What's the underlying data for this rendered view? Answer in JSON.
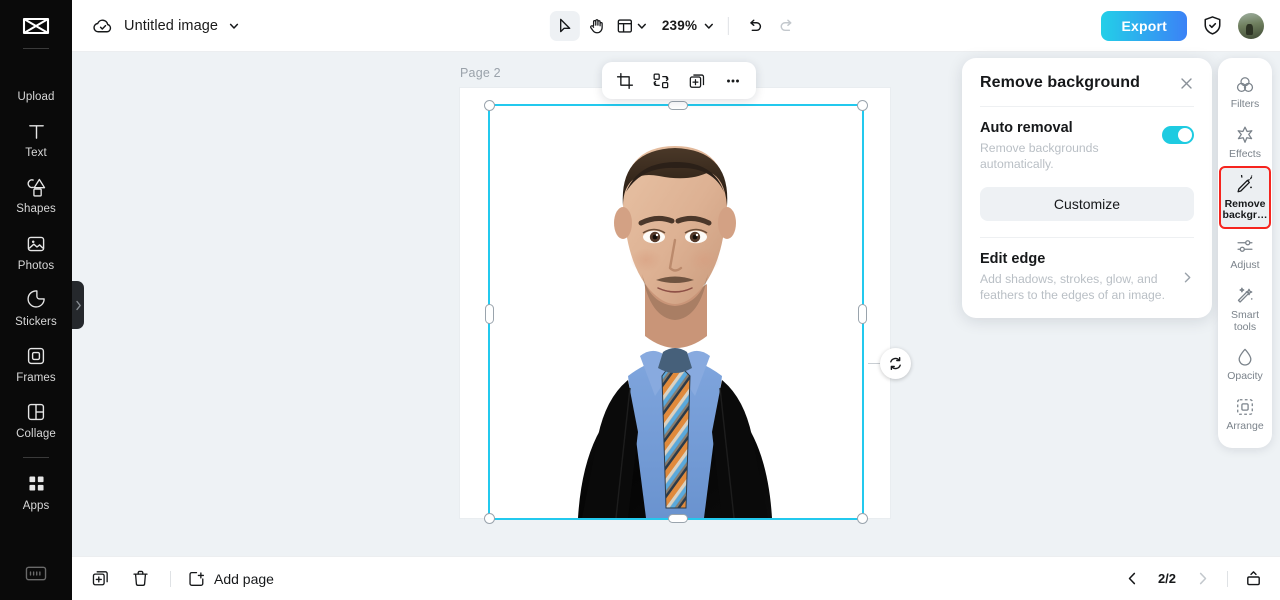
{
  "app": {
    "logo_icon": "capcut-logo-icon"
  },
  "left_sidebar": {
    "items": [
      {
        "label": "Upload",
        "icon": "upload-icon"
      },
      {
        "label": "Text",
        "icon": "text-icon"
      },
      {
        "label": "Shapes",
        "icon": "shapes-icon"
      },
      {
        "label": "Photos",
        "icon": "photos-icon"
      },
      {
        "label": "Stickers",
        "icon": "stickers-icon"
      },
      {
        "label": "Frames",
        "icon": "frames-icon"
      },
      {
        "label": "Collage",
        "icon": "collage-icon"
      },
      {
        "label": "Apps",
        "icon": "apps-icon"
      }
    ],
    "keyboard_shortcut_icon": "keyboard-icon",
    "collapse_icon": "chevron-right-icon"
  },
  "topbar": {
    "cloud_status_icon": "cloud-saved-icon",
    "document_title": "Untitled image",
    "title_dropdown_icon": "chevron-down-icon",
    "tools": [
      {
        "name": "select-tool",
        "icon": "cursor-arrow-icon",
        "active": true
      },
      {
        "name": "hand-tool",
        "icon": "hand-icon",
        "active": false
      },
      {
        "name": "layout-tool",
        "icon": "layout-icon",
        "active": false
      }
    ],
    "zoom_level": "239%",
    "zoom_dropdown_icon": "chevron-down-icon",
    "undo": {
      "icon": "undo-icon",
      "enabled": true
    },
    "redo": {
      "icon": "redo-icon",
      "enabled": false
    },
    "export_label": "Export",
    "shield_icon": "shield-check-icon",
    "avatar_icon": "user-avatar"
  },
  "canvas": {
    "page_label": "Page 2",
    "background_color": "#eef2f5",
    "selection_color": "#23c9ee",
    "rotate_icon": "rotate-icon",
    "float_toolbar": [
      {
        "name": "crop-button",
        "icon": "crop-icon"
      },
      {
        "name": "replace-button",
        "icon": "replace-icon"
      },
      {
        "name": "duplicate-button",
        "icon": "duplicate-icon"
      },
      {
        "name": "more-options-button",
        "icon": "ellipsis-icon"
      }
    ],
    "artwork_description": "Portrait of a man in a black suit, light blue shirt and striped tie on a white background"
  },
  "remove_background_panel": {
    "title": "Remove background",
    "close_icon": "close-icon",
    "auto_removal": {
      "title": "Auto removal",
      "description": "Remove backgrounds automatically.",
      "toggle_on": true,
      "toggle_color": "#1ecbe1"
    },
    "customize_label": "Customize",
    "edit_edge": {
      "title": "Edit edge",
      "description": "Add shadows, strokes, glow, and feathers to the edges of an image.",
      "chevron_icon": "chevron-right-icon"
    }
  },
  "right_rail": {
    "highlight_color": "#f6241e",
    "items": [
      {
        "label": "Filters",
        "icon": "filters-icon",
        "selected": false
      },
      {
        "label": "Effects",
        "icon": "effects-icon",
        "selected": false
      },
      {
        "label": "Remove backgr…",
        "icon": "remove-bg-icon",
        "selected": true
      },
      {
        "label": "Adjust",
        "icon": "adjust-icon",
        "selected": false
      },
      {
        "label": "Smart tools",
        "icon": "smart-tools-icon",
        "selected": false
      },
      {
        "label": "Opacity",
        "icon": "opacity-icon",
        "selected": false
      },
      {
        "label": "Arrange",
        "icon": "arrange-icon",
        "selected": false
      }
    ]
  },
  "bottombar": {
    "duplicate_page_icon": "duplicate-page-icon",
    "delete_page_icon": "trash-icon",
    "add_page_label": "Add page",
    "add_page_icon": "add-page-icon",
    "prev_icon": "chevron-left-icon",
    "page_indicator": "2/2",
    "next_icon": "chevron-right-icon",
    "panel_toggle_icon": "panel-toggle-icon"
  }
}
